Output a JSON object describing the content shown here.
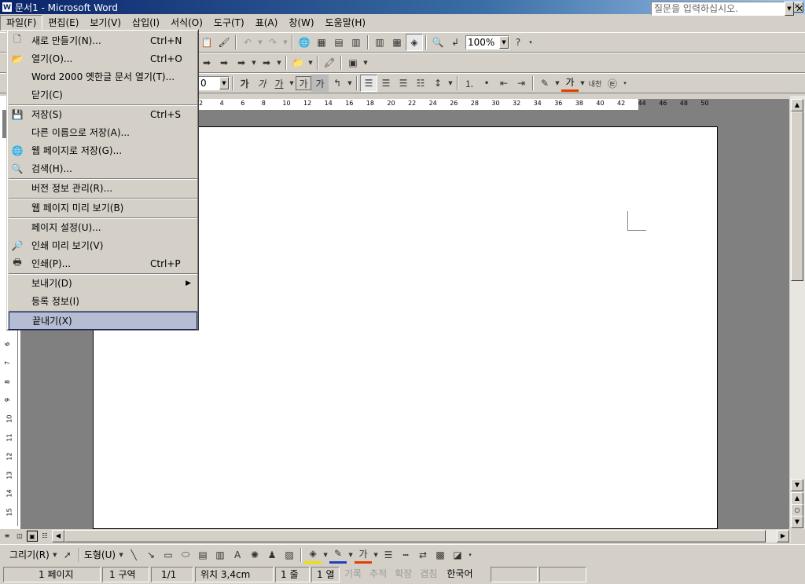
{
  "window": {
    "title": "문서1 - Microsoft Word",
    "app_icon": "W",
    "caption_buttons": [
      "minimize-icon",
      "restore-icon",
      "close-icon"
    ]
  },
  "menubar": {
    "items": [
      "파일(F)",
      "편집(E)",
      "보기(V)",
      "삽입(I)",
      "서식(O)",
      "도구(T)",
      "표(A)",
      "창(W)",
      "도움말(H)"
    ],
    "help_placeholder": "질문을 입력하십시오."
  },
  "toolbar_standard": {
    "zoom": "100%"
  },
  "toolbar_format": {
    "font_size": "0",
    "bold_glyph": "가",
    "italic_glyph": "가",
    "underline_glyph": "가",
    "highlight_glyph": "가",
    "color_glyph": "가",
    "ruby_glyph": "내천",
    "enclose_glyph": "㉫"
  },
  "hruler_ticks": [
    "2",
    "4",
    "6",
    "8",
    "10",
    "12",
    "14",
    "16",
    "18",
    "20",
    "22",
    "24",
    "26",
    "28",
    "30",
    "32",
    "34",
    "36",
    "38",
    "40",
    "42",
    "44",
    "46",
    "48",
    "50"
  ],
  "vruler_ticks": [
    "6",
    "7",
    "8",
    "9",
    "10",
    "11",
    "12",
    "13",
    "14",
    "15"
  ],
  "file_menu": {
    "items": [
      {
        "icon": "new-document-icon",
        "label": "새로 만들기(N)...",
        "shortcut": "Ctrl+N"
      },
      {
        "icon": "open-folder-icon",
        "label": "열기(O)...",
        "shortcut": "Ctrl+O"
      },
      {
        "icon": "",
        "label": "Word 2000 옛한글 문서 열기(T)...",
        "shortcut": ""
      },
      {
        "icon": "",
        "label": "닫기(C)",
        "shortcut": ""
      },
      {
        "icon": "save-icon",
        "label": "저장(S)",
        "shortcut": "Ctrl+S"
      },
      {
        "icon": "",
        "label": "다른 이름으로 저장(A)...",
        "shortcut": ""
      },
      {
        "icon": "web-save-icon",
        "label": "웹 페이지로 저장(G)...",
        "shortcut": ""
      },
      {
        "icon": "search-icon",
        "label": "검색(H)...",
        "shortcut": ""
      },
      {
        "icon": "",
        "label": "버전 정보 관리(R)...",
        "shortcut": ""
      },
      {
        "icon": "",
        "label": "웹 페이지 미리 보기(B)",
        "shortcut": ""
      },
      {
        "icon": "",
        "label": "페이지 설정(U)...",
        "shortcut": ""
      },
      {
        "icon": "print-preview-icon",
        "label": "인쇄 미리 보기(V)",
        "shortcut": ""
      },
      {
        "icon": "printer-icon",
        "label": "인쇄(P)...",
        "shortcut": "Ctrl+P"
      },
      {
        "icon": "",
        "label": "보내기(D)",
        "shortcut": ""
      },
      {
        "icon": "",
        "label": "등록 정보(I)",
        "shortcut": ""
      },
      {
        "icon": "",
        "label": "끝내기(X)",
        "shortcut": ""
      }
    ]
  },
  "drawbar": {
    "draw_label": "그리기(R)",
    "shapes_label": "도형(U)",
    "text_color_glyph": "가"
  },
  "statusbar": {
    "page": "1 페이지",
    "section": "1 구역",
    "pages": "1/1",
    "position": "위치 3,4cm",
    "line": "1 줄",
    "column": "1 열",
    "rec": "기록",
    "trk": "추적",
    "ext": "확장",
    "ovr": "겹침",
    "language": "한국어"
  },
  "colors": {
    "titlebar_start": "#0a246a",
    "highlight_fill": "#b6bdd2"
  }
}
